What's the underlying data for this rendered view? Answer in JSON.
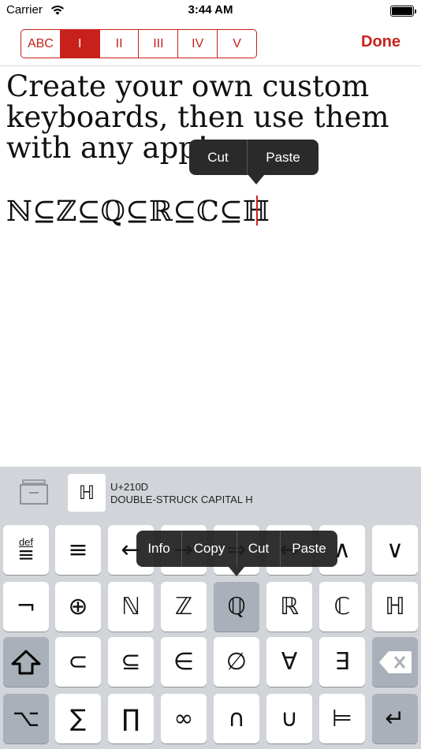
{
  "status_bar": {
    "carrier": "Carrier",
    "time": "3:44 AM",
    "battery_level": 1.0
  },
  "navbar": {
    "segments": [
      "ABC",
      "I",
      "II",
      "III",
      "IV",
      "V"
    ],
    "active_segment": "I",
    "done_label": "Done"
  },
  "editor": {
    "lines": [
      "Create your own custom",
      "keyboards, then use them",
      "with any app!"
    ],
    "formula": "ℕ⊆ℤ⊆ℚ⊆ℝ⊆ℂ⊆ℍ"
  },
  "text_menu": {
    "cut": "Cut",
    "paste": "Paste"
  },
  "keyboard": {
    "char_preview": "ℍ",
    "codepoint": "U+210D",
    "char_name": "DOUBLE-STRUCK CAPITAL H",
    "key_menu": {
      "info": "Info",
      "copy": "Copy",
      "cut": "Cut",
      "paste": "Paste"
    },
    "def_key": {
      "small": "def",
      "symbol": "≡"
    },
    "row1": [
      "≡",
      "←",
      "→",
      "⇒",
      "↔",
      "∧",
      "∨"
    ],
    "row2": [
      "¬",
      "⊕",
      "ℕ",
      "ℤ",
      "ℚ",
      "ℝ",
      "ℂ",
      "ℍ"
    ],
    "row3": [
      "⇧",
      "⊂",
      "⊆",
      "∈",
      "∅",
      "∀",
      "∃",
      "⌫"
    ],
    "row4": [
      "⌥",
      "∑",
      "∏",
      "∞",
      "∩",
      "∪",
      "⊨",
      "↵"
    ]
  },
  "colors": {
    "accent": "#c8201b",
    "keyboard_bg": "#d1d4d9",
    "callout_bg": "#2a2a2a"
  }
}
